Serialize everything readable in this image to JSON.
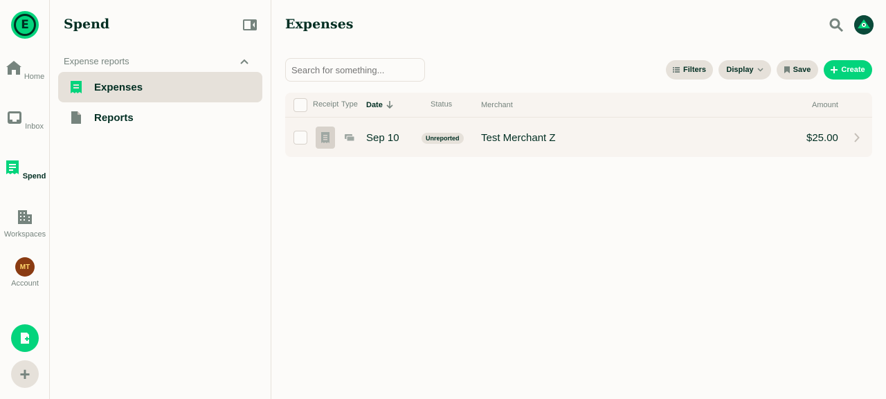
{
  "rail": {
    "logo_letter": "E",
    "items": [
      {
        "label": "Home",
        "icon": "home-icon"
      },
      {
        "label": "Inbox",
        "icon": "inbox-icon"
      },
      {
        "label": "Spend",
        "icon": "receipt-icon"
      },
      {
        "label": "Workspaces",
        "icon": "building-icon"
      },
      {
        "label": "Account",
        "icon": "avatar",
        "initials": "MT"
      }
    ],
    "fab_plus": "+"
  },
  "sidebar": {
    "title": "Spend",
    "section": "Expense reports",
    "items": [
      {
        "label": "Expenses",
        "active": true
      },
      {
        "label": "Reports",
        "active": false
      }
    ]
  },
  "main": {
    "title": "Expenses",
    "search_placeholder": "Search for something...",
    "toolbar": {
      "filters": "Filters",
      "display": "Display",
      "save": "Save",
      "create": "Create"
    },
    "table": {
      "headers": {
        "receipt": "Receipt",
        "type": "Type",
        "date": "Date",
        "status": "Status",
        "merchant": "Merchant",
        "amount": "Amount"
      },
      "rows": [
        {
          "date": "Sep 10",
          "status": "Unreported",
          "merchant": "Test Merchant Z",
          "amount": "$25.00"
        }
      ]
    }
  },
  "colors": {
    "accent": "#03d47c",
    "text": "#002e22",
    "muted": "#76847e",
    "border": "#e6e1da"
  }
}
